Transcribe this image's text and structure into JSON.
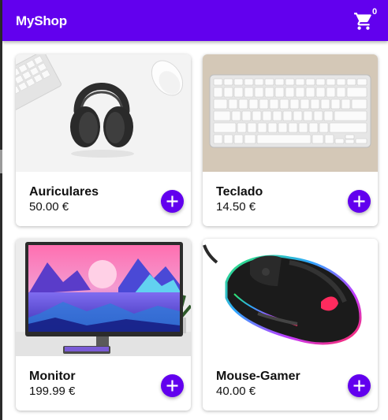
{
  "app": {
    "title": "MyShop",
    "accent": "#6200ee"
  },
  "cart": {
    "icon": "shopping-cart-icon",
    "count": "0"
  },
  "products": [
    {
      "name": "Auriculares",
      "price": "50.00 €",
      "image": "headphones-photo"
    },
    {
      "name": "Teclado",
      "price": "14.50 €",
      "image": "keyboard-photo"
    },
    {
      "name": "Monitor",
      "price": "199.99 €",
      "image": "monitor-photo"
    },
    {
      "name": "Mouse-Gamer",
      "price": "40.00 €",
      "image": "gaming-mouse-photo"
    }
  ],
  "add_button_icon": "plus-icon"
}
